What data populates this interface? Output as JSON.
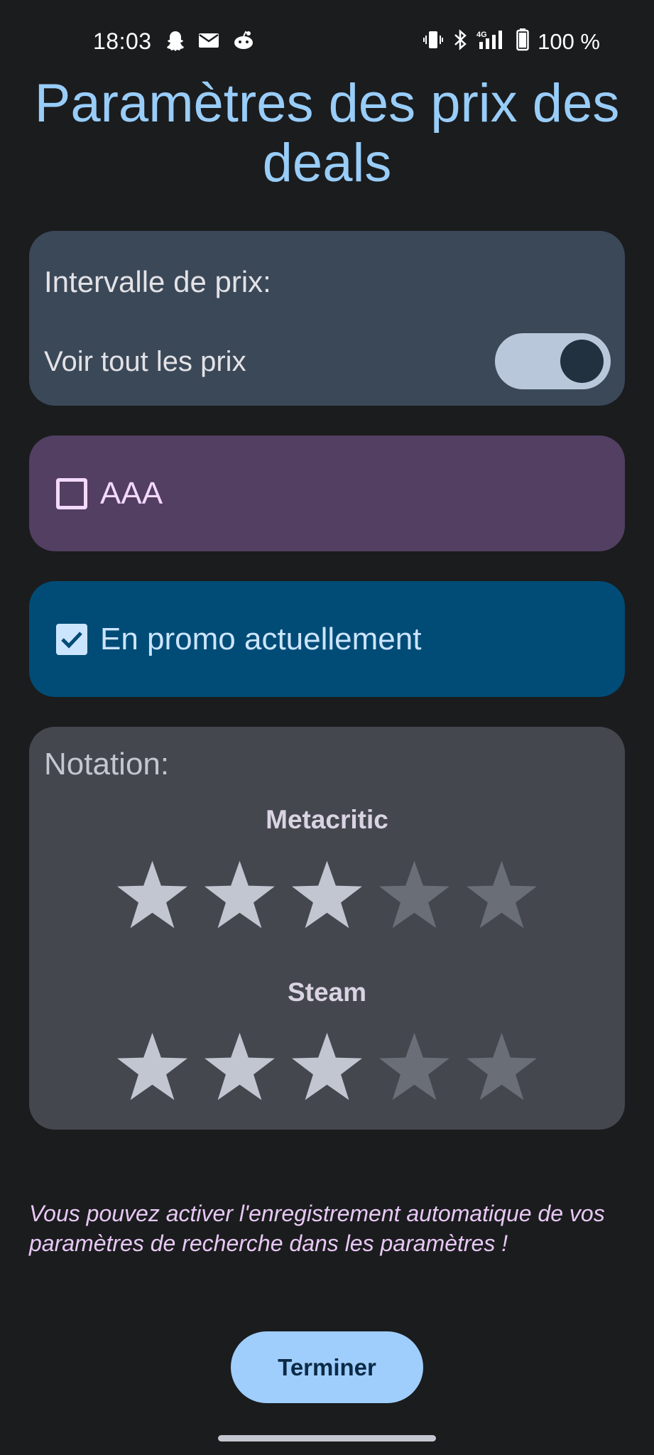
{
  "status_bar": {
    "time": "18:03",
    "battery": "100 %",
    "left_icons": [
      "snapchat-icon",
      "mail-icon",
      "reddit-icon"
    ],
    "right_icons": [
      "vibrate-icon",
      "bluetooth-icon",
      "signal-4g-icon",
      "battery-icon"
    ]
  },
  "header": {
    "title": "Paramètres des prix des deals"
  },
  "price_card": {
    "label": "Intervalle de prix:",
    "show_all_label": "Voir tout les prix",
    "show_all_enabled": true
  },
  "filters": {
    "aaa": {
      "label": "AAA",
      "checked": false
    },
    "promo": {
      "label": "En promo actuellement",
      "checked": true
    }
  },
  "rating": {
    "title": "Notation:",
    "metacritic": {
      "label": "Metacritic",
      "stars": 3,
      "max": 5
    },
    "steam": {
      "label": "Steam",
      "stars": 3,
      "max": 5
    }
  },
  "hint": {
    "text": "Vous pouvez activer l'enregistrement automatique de vos paramètres de recherche dans les paramètres !"
  },
  "actions": {
    "finish_label": "Terminer"
  },
  "colors": {
    "background": "#1b1c1e",
    "title": "#99cdf9",
    "price_card": "#3b4858",
    "aaa_card": "#523f61",
    "promo_card": "#004c76",
    "rating_card": "#44474e",
    "star_on": "#c1c6d0",
    "star_off": "#6a6e77",
    "button": "#9fcefd"
  }
}
